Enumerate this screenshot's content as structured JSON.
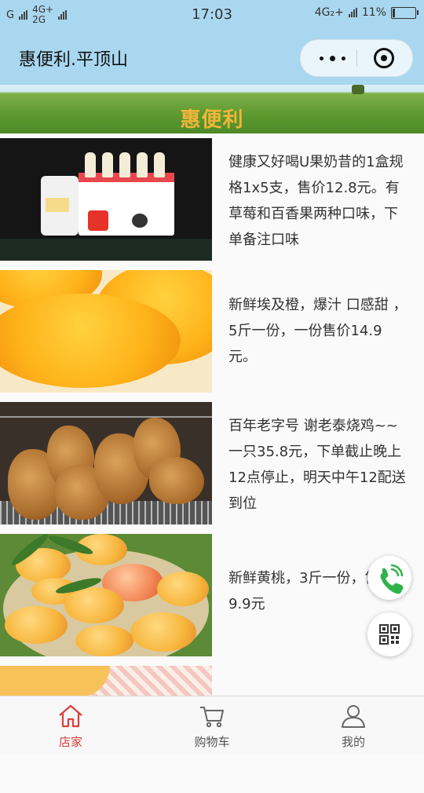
{
  "status_bar": {
    "left_signal_1": "G",
    "left_net_1": "4G+",
    "left_net_2": "2G",
    "time": "17:03",
    "right_net": "4G₂+",
    "battery": "11%",
    "battery_level": 0.11
  },
  "nav": {
    "title": "惠便利.平顶山"
  },
  "banner": {
    "text": "惠便利"
  },
  "products": [
    {
      "description": "健康又好喝U果奶昔的1盒规格1x5支，售价12.8元。有草莓和百香果两种口味，下单备注口味",
      "image": "milkshake-box"
    },
    {
      "description": "新鲜埃及橙，爆汁 口感甜 ，5斤一份，一份售价14.9元。",
      "image": "orange-slices"
    },
    {
      "description": "百年老字号 谢老泰烧鸡~~一只35.8元，下单截止晚上12点停止，明天中午12配送到位",
      "image": "roast-chicken"
    },
    {
      "description": "新鲜黄桃，3斤一份，售价9.9元",
      "image": "yellow-peaches"
    },
    {
      "description": "",
      "image": "mango"
    }
  ],
  "tabs": [
    {
      "label": "店家",
      "icon": "home-icon",
      "active": true
    },
    {
      "label": "购物车",
      "icon": "cart-icon",
      "active": false
    },
    {
      "label": "我的",
      "icon": "user-icon",
      "active": false
    }
  ],
  "colors": {
    "header_bg": "#a9d7ef",
    "tab_active": "#d9413a",
    "call_icon": "#2fb34a"
  }
}
